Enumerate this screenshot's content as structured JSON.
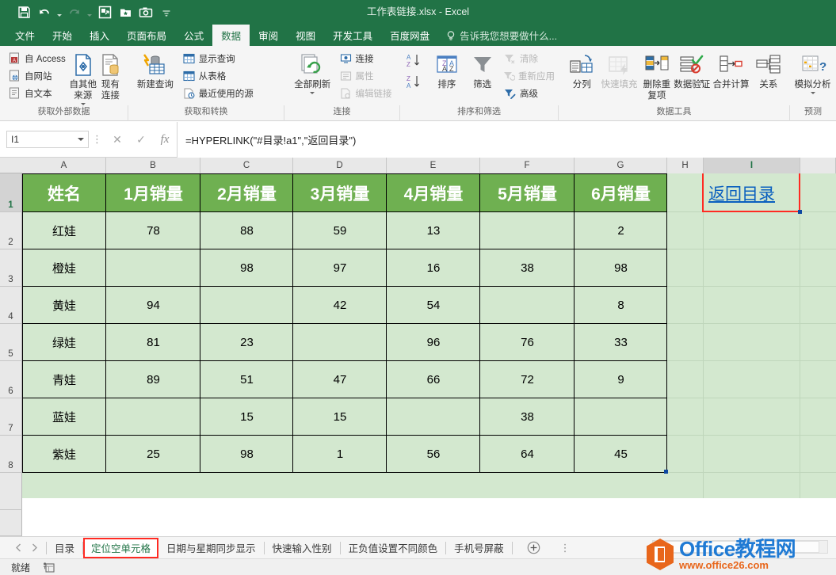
{
  "window": {
    "title": "工作表链接.xlsx - Excel",
    "quick_access": [
      {
        "name": "save-icon",
        "label": "保存"
      },
      {
        "name": "undo-icon",
        "label": "撤消"
      },
      {
        "name": "redo-icon",
        "label": "恢复"
      },
      {
        "name": "frame-icon",
        "label": "插入图片框"
      },
      {
        "name": "star-folder-icon",
        "label": "收藏"
      },
      {
        "name": "camera-icon",
        "label": "照相机"
      },
      {
        "name": "customize-qat-icon",
        "label": "自定义快速访问工具栏"
      }
    ]
  },
  "ribbon": {
    "tabs": [
      {
        "label": "文件",
        "active": false
      },
      {
        "label": "开始",
        "active": false
      },
      {
        "label": "插入",
        "active": false
      },
      {
        "label": "页面布局",
        "active": false
      },
      {
        "label": "公式",
        "active": false
      },
      {
        "label": "数据",
        "active": true
      },
      {
        "label": "审阅",
        "active": false
      },
      {
        "label": "视图",
        "active": false
      },
      {
        "label": "开发工具",
        "active": false
      },
      {
        "label": "百度网盘",
        "active": false
      }
    ],
    "tell_me": "告诉我您想要做什么...",
    "groups": [
      {
        "label": "获取外部数据",
        "small_buttons": [
          "自 Access",
          "自网站",
          "自文本"
        ],
        "big_buttons": [
          "自其他来源",
          "现有连接"
        ]
      },
      {
        "label": "获取和转换",
        "big_buttons": [
          "新建查询"
        ],
        "small_buttons": [
          "显示查询",
          "从表格",
          "最近使用的源"
        ]
      },
      {
        "label": "连接",
        "big_buttons": [
          "全部刷新"
        ],
        "small_buttons": [
          "连接",
          "属性",
          "编辑链接"
        ]
      },
      {
        "label": "排序和筛选",
        "big_buttons": [
          "排序",
          "筛选"
        ],
        "small_buttons": [
          "清除",
          "重新应用",
          "高级"
        ]
      },
      {
        "label": "数据工具",
        "big_buttons": [
          "分列",
          "快速填充",
          "删除重复项",
          "数据验证",
          "合并计算",
          "关系"
        ]
      },
      {
        "label": "预测",
        "big_buttons": [
          "模拟分析"
        ]
      }
    ]
  },
  "formula_bar": {
    "name_box": "I1",
    "cancel_label": "取消",
    "enter_label": "输入",
    "fx_label": "fx",
    "formula": "=HYPERLINK(\"#目录!a1\",\"返回目录\")"
  },
  "grid": {
    "columns": [
      "A",
      "B",
      "C",
      "D",
      "E",
      "F",
      "G",
      "H",
      "I"
    ],
    "selected_column": "I",
    "rows": [
      "1",
      "2",
      "3",
      "4",
      "5",
      "6",
      "7",
      "8"
    ],
    "selected_row": "1",
    "selected_cell": "I1",
    "headers": [
      "姓名",
      "1月销量",
      "2月销量",
      "3月销量",
      "4月销量",
      "5月销量",
      "6月销量"
    ],
    "data": [
      {
        "name": "红娃",
        "values": [
          "78",
          "88",
          "59",
          "13",
          "",
          "2"
        ]
      },
      {
        "name": "橙娃",
        "values": [
          "",
          "98",
          "97",
          "16",
          "38",
          "98"
        ]
      },
      {
        "name": "黄娃",
        "values": [
          "94",
          "",
          "42",
          "54",
          "",
          "8"
        ]
      },
      {
        "name": "绿娃",
        "values": [
          "81",
          "23",
          "",
          "96",
          "76",
          "33"
        ]
      },
      {
        "name": "青娃",
        "values": [
          "89",
          "51",
          "47",
          "66",
          "72",
          "9"
        ]
      },
      {
        "name": "蓝娃",
        "values": [
          "",
          "15",
          "15",
          "",
          "38",
          ""
        ]
      },
      {
        "name": "紫娃",
        "values": [
          "25",
          "98",
          "1",
          "56",
          "64",
          "45"
        ]
      }
    ],
    "link_cell": {
      "address": "I1",
      "text": "返回目录"
    },
    "colors": {
      "header_fill": "#6fb051",
      "data_fill": "#d3e8cf",
      "link_text": "#0a5fbf",
      "highlight_box": "#ff2a22",
      "accent": "#217346"
    }
  },
  "sheet_tabs": {
    "prev_label": "上一张工作表",
    "next_label": "下一张工作表",
    "tabs": [
      {
        "label": "目录",
        "active": false,
        "highlighted": false
      },
      {
        "label": "定位空单元格",
        "active": true,
        "highlighted": true
      },
      {
        "label": "日期与星期同步显示",
        "active": false,
        "highlighted": false
      },
      {
        "label": "快速输入性别",
        "active": false,
        "highlighted": false
      },
      {
        "label": "正负值设置不同颜色",
        "active": false,
        "highlighted": false
      },
      {
        "label": "手机号屏蔽",
        "active": false,
        "highlighted": false
      }
    ],
    "add_sheet_label": "新建工作表"
  },
  "status_bar": {
    "state": "就绪",
    "icon_label": "辅助功能检查器"
  },
  "watermark": {
    "brand": "Office教程网",
    "url": "www.office26.com"
  }
}
